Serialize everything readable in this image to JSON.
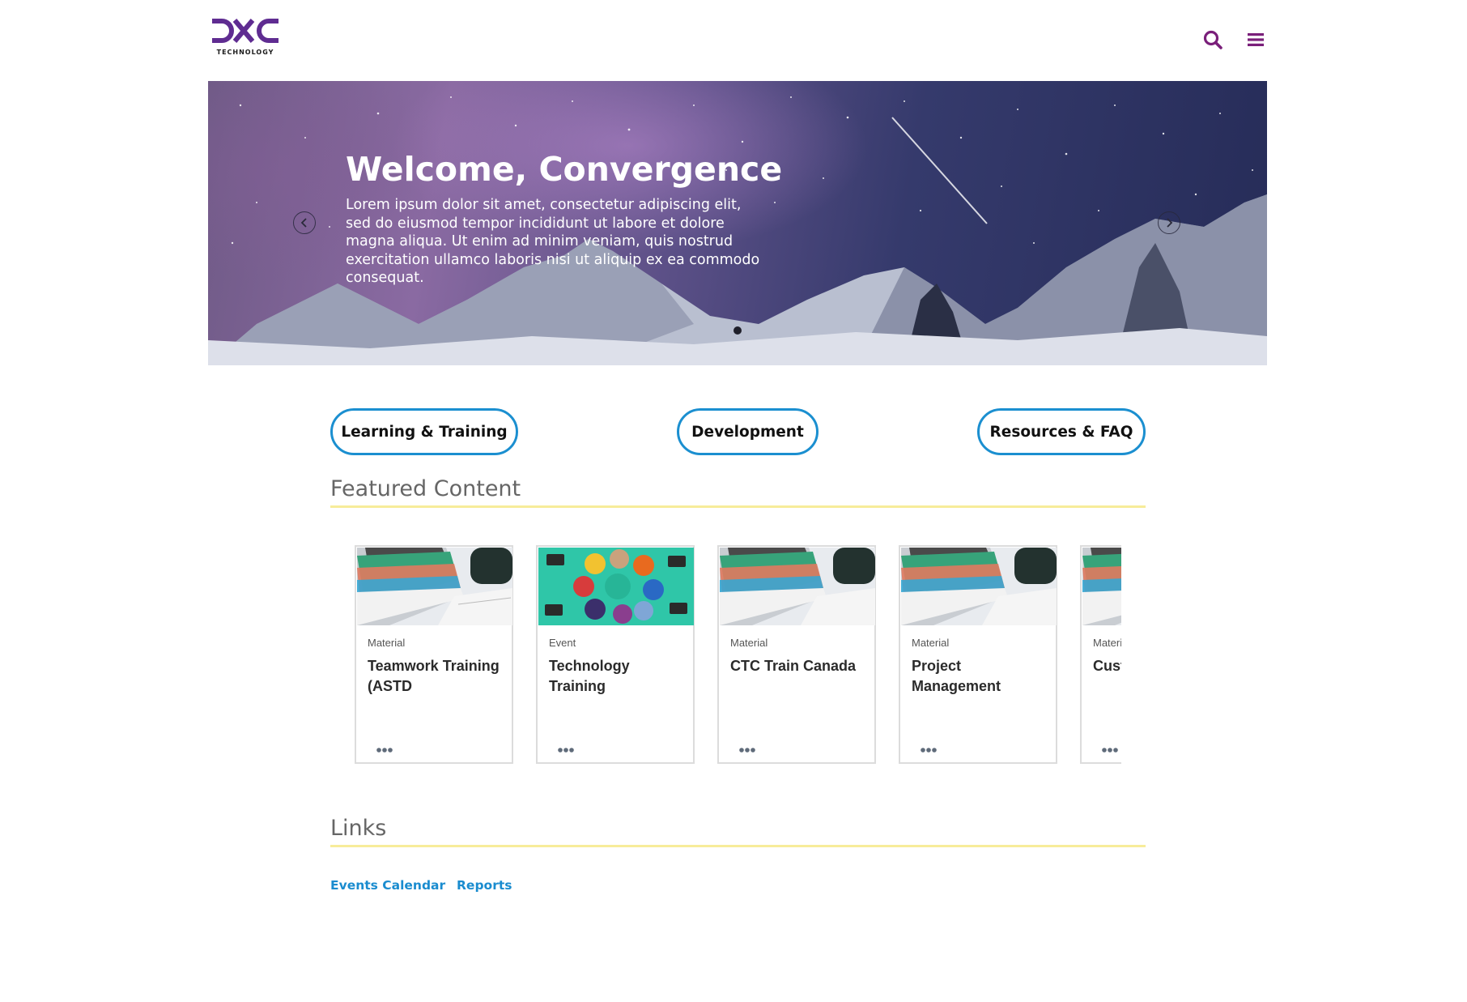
{
  "brand": {
    "logo_text": "DXC",
    "logo_subtext": "TECHNOLOGY",
    "accent_purple": "#5f2c91",
    "icon_purple": "#7a1f7a"
  },
  "header": {
    "search_icon": "search-icon",
    "menu_icon": "hamburger-menu-icon"
  },
  "hero": {
    "title": "Welcome, Convergence",
    "text": "Lorem ipsum dolor sit amet, consectetur adipiscing elit, sed do eiusmod tempor incididunt ut labore et dolore magna aliqua. Ut enim ad minim veniam, quis nostrud exercitation ullamco laboris nisi ut aliquip ex ea commodo consequat.",
    "prev_icon": "chevron-left-icon",
    "next_icon": "chevron-right-icon"
  },
  "categories": [
    {
      "label": "Learning & Training"
    },
    {
      "label": "Development"
    },
    {
      "label": "Resources & FAQ"
    }
  ],
  "featured": {
    "title": "Featured Content",
    "cards": [
      {
        "type": "Material",
        "title": "Teamwork Training (ASTD",
        "image": "books-desk"
      },
      {
        "type": "Event",
        "title": "Technology Training",
        "image": "people-circle"
      },
      {
        "type": "Material",
        "title": "CTC Train Canada",
        "image": "books-desk"
      },
      {
        "type": "Material",
        "title": "Project Management",
        "image": "books-desk"
      },
      {
        "type": "Material",
        "title": "Customer Training",
        "image": "books-desk"
      }
    ]
  },
  "links": {
    "title": "Links",
    "items": [
      {
        "label": "Events Calendar"
      },
      {
        "label": "Reports"
      }
    ]
  },
  "colors": {
    "button_border": "#1b8fd0",
    "section_rule": "#f7ec9a",
    "link": "#1a8ccf"
  }
}
